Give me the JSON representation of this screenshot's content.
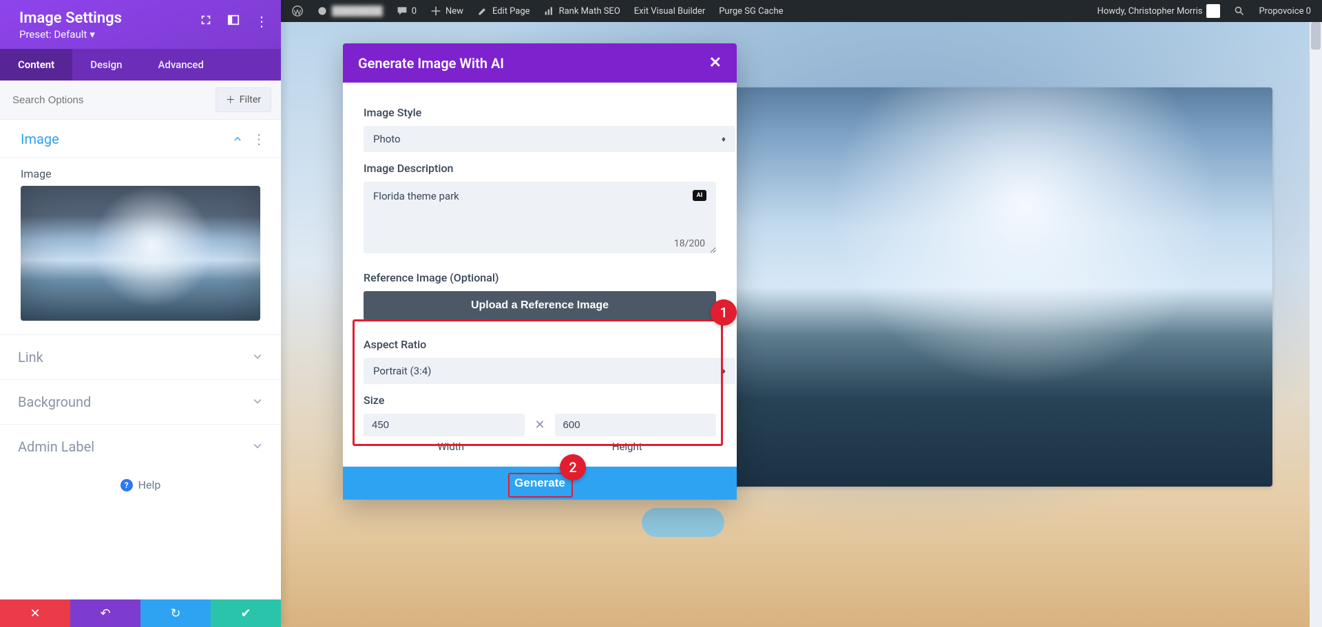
{
  "admin_bar": {
    "site_name": "",
    "comments": "0",
    "new": "New",
    "edit_page": "Edit Page",
    "rank_math": "Rank Math SEO",
    "exit_builder": "Exit Visual Builder",
    "purge_cache": "Purge SG Cache",
    "howdy": "Howdy, Christopher Morris",
    "propovoice": "Propovoice 0"
  },
  "sidebar": {
    "title": "Image Settings",
    "preset": "Preset: Default",
    "tabs": {
      "content": "Content",
      "design": "Design",
      "advanced": "Advanced"
    },
    "search_placeholder": "Search Options",
    "filter": "Filter",
    "groups": {
      "image": "Image",
      "image_field_label": "Image",
      "link": "Link",
      "background": "Background",
      "admin_label": "Admin Label"
    },
    "help": "Help"
  },
  "modal": {
    "title": "Generate Image With AI",
    "style_label": "Image Style",
    "style_value": "Photo",
    "desc_label": "Image Description",
    "desc_value": "Florida theme park",
    "char_count": "18/200",
    "ai_badge": "AI",
    "ref_label": "Reference Image (Optional)",
    "upload_label": "Upload a Reference Image",
    "aspect_label": "Aspect Ratio",
    "aspect_value": "Portrait (3:4)",
    "size_label": "Size",
    "width": "450",
    "height": "600",
    "width_label": "Width",
    "height_label": "Height",
    "generate": "Generate"
  },
  "annotations": {
    "a1": "1",
    "a2": "2"
  }
}
